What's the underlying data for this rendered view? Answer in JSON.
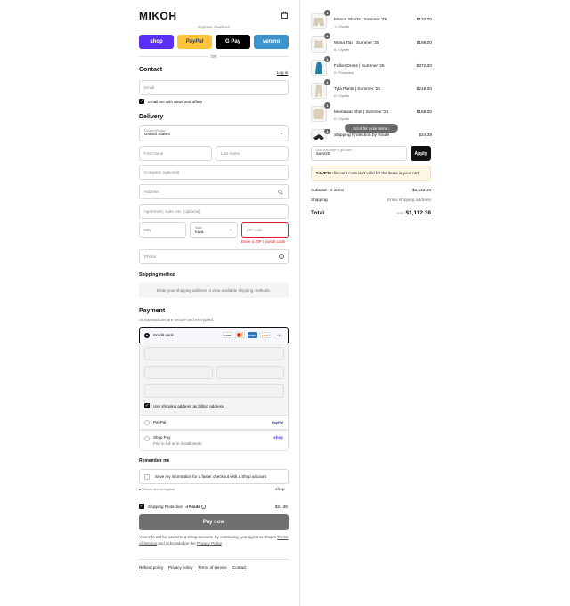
{
  "header": {
    "logo": "MIKOH",
    "cart_icon": "shopping-bag-icon"
  },
  "express": {
    "label": "Express checkout",
    "buttons": [
      {
        "label": "shop",
        "bg": "#5a31f4",
        "fg": "#ffffff"
      },
      {
        "label": "PayPal",
        "bg": "#ffc439",
        "fg": "#253b80"
      },
      {
        "label": "G Pay",
        "bg": "#000000",
        "fg": "#ffffff"
      },
      {
        "label": "venmo",
        "bg": "#3d95ce",
        "fg": "#ffffff"
      }
    ],
    "or": "OR"
  },
  "contact": {
    "title": "Contact",
    "login": "Log in",
    "email_placeholder": "Email",
    "newsletter": "Email me with news and offers"
  },
  "delivery": {
    "title": "Delivery",
    "country_label": "Country/Region",
    "country_value": "United States",
    "first_name": "First name",
    "last_name": "Last name",
    "company": "Company (optional)",
    "address": "Address",
    "apartment": "Apartment, suite, etc. (optional)",
    "city": "City",
    "state_label": "State",
    "state_value": "Iowa",
    "zip": "ZIP code",
    "zip_error": "Enter a ZIP / postal code",
    "phone": "Phone"
  },
  "shipping": {
    "title": "Shipping method",
    "note": "Enter your shipping address to view available shipping methods."
  },
  "payment": {
    "title": "Payment",
    "subtitle": "All transactions are secure and encrypted.",
    "credit_card": "Credit card",
    "card_brands": [
      "VISA",
      "MC",
      "AMEX",
      "DISC"
    ],
    "more_brands": "+4",
    "billing_same": "Use shipping address as billing address",
    "paypal": "PayPal",
    "paypal_logo": "PayPal",
    "shop_pay": "Shop Pay",
    "shop_pay_sub": "Pay in full or in installments",
    "shop_logo": "shop"
  },
  "remember": {
    "title": "Remember me",
    "save_info": "Save my information for a faster checkout with a Shop account",
    "secure": "Secure and encrypted",
    "shop_logo": "shop"
  },
  "protection": {
    "label": "Shipping Protection",
    "brand": "Route",
    "price": "$24.38"
  },
  "pay_now": "Pay now",
  "legal": {
    "prefix": "Your info will be saved to a Shop account. By continuing, you agree to Shop's",
    "terms": "Terms of Service",
    "middle": "and acknowledge the",
    "privacy": "Privacy Policy",
    "suffix": "."
  },
  "footer": [
    "Refund policy",
    "Privacy policy",
    "Terms of service",
    "Contact"
  ],
  "order": {
    "items": [
      {
        "qty": "1",
        "name": "Mason Shorts | Summer '25",
        "variant": "1 / Oyster",
        "price": "$132.00"
      },
      {
        "qty": "1",
        "name": "Mona Top | Summer '25",
        "variant": "0 / Oyster",
        "price": "$198.00"
      },
      {
        "qty": "1",
        "name": "Fallon Dress | Summer '25",
        "variant": "0 / Poseidon",
        "price": "$372.00"
      },
      {
        "qty": "1",
        "name": "Tyla Pants | Summer '25",
        "variant": "0 / Oyster",
        "price": "$218.00"
      },
      {
        "qty": "1",
        "name": "Mentawai Shirt | Summer '25",
        "variant": "0 / Oyster",
        "price": "$168.00"
      },
      {
        "qty": "1",
        "name": "Shipping Protection by Route",
        "variant": "",
        "price": "$24.38"
      }
    ],
    "scroll_hint": "Scroll for more items",
    "discount_label": "Discount code or gift card",
    "discount_value": "save20",
    "apply": "Apply",
    "notice_code": "SAVE20",
    "notice_text": "discount code isn't valid for the items in your cart",
    "subtotal_label": "Subtotal · 6 items",
    "subtotal_value": "$1,112.38",
    "shipping_label": "Shipping",
    "shipping_value": "Enter shipping address",
    "total_label": "Total",
    "currency": "USD",
    "total_value": "$1,112.38"
  }
}
